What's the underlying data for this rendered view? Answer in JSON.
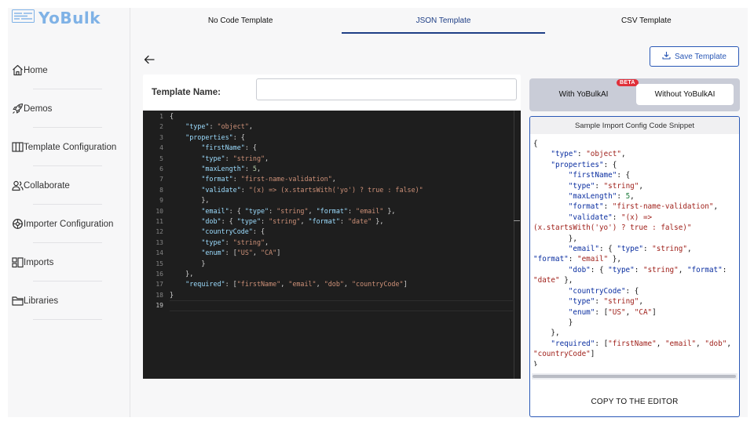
{
  "logo": {
    "text": "YoBulk"
  },
  "nav": [
    {
      "id": "home",
      "label": "Home",
      "icon": "home-icon"
    },
    {
      "id": "demos",
      "label": "Demos",
      "icon": "rocket-icon"
    },
    {
      "id": "template-configuration",
      "label": "Template Configuration",
      "icon": "columns-icon"
    },
    {
      "id": "collaborate",
      "label": "Collaborate",
      "icon": "users-icon"
    },
    {
      "id": "importer-configuration",
      "label": "Importer Configuration",
      "icon": "settings-icon"
    },
    {
      "id": "imports",
      "label": "Imports",
      "icon": "imports-icon"
    },
    {
      "id": "libraries",
      "label": "Libraries",
      "icon": "folder-icon"
    }
  ],
  "tabs": [
    {
      "label": "No Code Template",
      "active": false
    },
    {
      "label": "JSON Template",
      "active": true
    },
    {
      "label": "CSV Template",
      "active": false
    }
  ],
  "save_button": {
    "label": "Save Template"
  },
  "template_name": {
    "label": "Template Name:",
    "value": "",
    "placeholder": ""
  },
  "editor": {
    "current_line": 19,
    "lines": [
      [
        [
          "p",
          "{"
        ]
      ],
      [
        [
          "p",
          "    "
        ],
        [
          "k",
          "\"type\""
        ],
        [
          "p",
          ": "
        ],
        [
          "s",
          "\"object\""
        ],
        [
          "p",
          ","
        ]
      ],
      [
        [
          "p",
          "    "
        ],
        [
          "k",
          "\"properties\""
        ],
        [
          "p",
          ": {"
        ]
      ],
      [
        [
          "p",
          "        "
        ],
        [
          "k",
          "\"firstName\""
        ],
        [
          "p",
          ": {"
        ]
      ],
      [
        [
          "p",
          "        "
        ],
        [
          "k",
          "\"type\""
        ],
        [
          "p",
          ": "
        ],
        [
          "s",
          "\"string\""
        ],
        [
          "p",
          ","
        ]
      ],
      [
        [
          "p",
          "        "
        ],
        [
          "k",
          "\"maxLength\""
        ],
        [
          "p",
          ": "
        ],
        [
          "n",
          "5"
        ],
        [
          "p",
          ","
        ]
      ],
      [
        [
          "p",
          "        "
        ],
        [
          "k",
          "\"format\""
        ],
        [
          "p",
          ": "
        ],
        [
          "s",
          "\"first-name-validation\""
        ],
        [
          "p",
          ","
        ]
      ],
      [
        [
          "p",
          "        "
        ],
        [
          "k",
          "\"validate\""
        ],
        [
          "p",
          ": "
        ],
        [
          "s",
          "\"(x) => (x.startsWith('yo') ? true : false)\""
        ]
      ],
      [
        [
          "p",
          "        },"
        ]
      ],
      [
        [
          "p",
          "        "
        ],
        [
          "k",
          "\"email\""
        ],
        [
          "p",
          ": { "
        ],
        [
          "k",
          "\"type\""
        ],
        [
          "p",
          ": "
        ],
        [
          "s",
          "\"string\""
        ],
        [
          "p",
          ", "
        ],
        [
          "k",
          "\"format\""
        ],
        [
          "p",
          ": "
        ],
        [
          "s",
          "\"email\""
        ],
        [
          "p",
          " },"
        ]
      ],
      [
        [
          "p",
          "        "
        ],
        [
          "k",
          "\"dob\""
        ],
        [
          "p",
          ": { "
        ],
        [
          "k",
          "\"type\""
        ],
        [
          "p",
          ": "
        ],
        [
          "s",
          "\"string\""
        ],
        [
          "p",
          ", "
        ],
        [
          "k",
          "\"format\""
        ],
        [
          "p",
          ": "
        ],
        [
          "s",
          "\"date\""
        ],
        [
          "p",
          " },"
        ]
      ],
      [
        [
          "p",
          "        "
        ],
        [
          "k",
          "\"countryCode\""
        ],
        [
          "p",
          ": {"
        ]
      ],
      [
        [
          "p",
          "        "
        ],
        [
          "k",
          "\"type\""
        ],
        [
          "p",
          ": "
        ],
        [
          "s",
          "\"string\""
        ],
        [
          "p",
          ","
        ]
      ],
      [
        [
          "p",
          "        "
        ],
        [
          "k",
          "\"enum\""
        ],
        [
          "p",
          ": ["
        ],
        [
          "s",
          "\"US\""
        ],
        [
          "p",
          ", "
        ],
        [
          "s",
          "\"CA\""
        ],
        [
          "p",
          "]"
        ]
      ],
      [
        [
          "p",
          "        }"
        ]
      ],
      [
        [
          "p",
          "    },"
        ]
      ],
      [
        [
          "p",
          "    "
        ],
        [
          "k",
          "\"required\""
        ],
        [
          "p",
          ": ["
        ],
        [
          "s",
          "\"firstName\""
        ],
        [
          "p",
          ", "
        ],
        [
          "s",
          "\"email\""
        ],
        [
          "p",
          ", "
        ],
        [
          "s",
          "\"dob\""
        ],
        [
          "p",
          ", "
        ],
        [
          "s",
          "\"countryCode\""
        ],
        [
          "p",
          "]"
        ]
      ],
      [
        [
          "p",
          "}"
        ]
      ],
      []
    ]
  },
  "ai_toggle": {
    "with_label": "With YoBulkAI",
    "beta_label": "BETA",
    "without_label": "Without YoBulkAI",
    "selected": "without"
  },
  "snippet": {
    "title": "Sample Import Config Code Snippet",
    "tokens": [
      [
        "p",
        "{\n    "
      ],
      [
        "k",
        "\"type\""
      ],
      [
        "p",
        ": "
      ],
      [
        "s",
        "\"object\""
      ],
      [
        "p",
        ",\n    "
      ],
      [
        "k",
        "\"properties\""
      ],
      [
        "p",
        ": {\n        "
      ],
      [
        "k",
        "\"firstName\""
      ],
      [
        "p",
        ": {\n        "
      ],
      [
        "k",
        "\"type\""
      ],
      [
        "p",
        ": "
      ],
      [
        "s",
        "\"string\""
      ],
      [
        "p",
        ",\n        "
      ],
      [
        "k",
        "\"maxLength\""
      ],
      [
        "p",
        ": "
      ],
      [
        "n",
        "5"
      ],
      [
        "p",
        ",\n        "
      ],
      [
        "k",
        "\"format\""
      ],
      [
        "p",
        ": "
      ],
      [
        "s",
        "\"first-name-validation\""
      ],
      [
        "p",
        ",\n        "
      ],
      [
        "k",
        "\"validate\""
      ],
      [
        "p",
        ": "
      ],
      [
        "s",
        "\"(x) =>\n(x.startsWith('yo') ? true : false)\""
      ],
      [
        "p",
        "\n        },\n        "
      ],
      [
        "k",
        "\"email\""
      ],
      [
        "p",
        ": { "
      ],
      [
        "k",
        "\"type\""
      ],
      [
        "p",
        ": "
      ],
      [
        "s",
        "\"string\""
      ],
      [
        "p",
        ",\n"
      ],
      [
        "k",
        "\"format\""
      ],
      [
        "p",
        ": "
      ],
      [
        "s",
        "\"email\""
      ],
      [
        "p",
        " },\n        "
      ],
      [
        "k",
        "\"dob\""
      ],
      [
        "p",
        ": { "
      ],
      [
        "k",
        "\"type\""
      ],
      [
        "p",
        ": "
      ],
      [
        "s",
        "\"string\""
      ],
      [
        "p",
        ", "
      ],
      [
        "k",
        "\"format\""
      ],
      [
        "p",
        ":\n"
      ],
      [
        "s",
        "\"date\""
      ],
      [
        "p",
        " },\n        "
      ],
      [
        "k",
        "\"countryCode\""
      ],
      [
        "p",
        ": {\n        "
      ],
      [
        "k",
        "\"type\""
      ],
      [
        "p",
        ": "
      ],
      [
        "s",
        "\"string\""
      ],
      [
        "p",
        ",\n        "
      ],
      [
        "k",
        "\"enum\""
      ],
      [
        "p",
        ": ["
      ],
      [
        "s",
        "\"US\""
      ],
      [
        "p",
        ", "
      ],
      [
        "s",
        "\"CA\""
      ],
      [
        "p",
        "]\n        }\n    },\n    "
      ],
      [
        "k",
        "\"required\""
      ],
      [
        "p",
        ": ["
      ],
      [
        "s",
        "\"firstName\""
      ],
      [
        "p",
        ", "
      ],
      [
        "s",
        "\"email\""
      ],
      [
        "p",
        ", "
      ],
      [
        "s",
        "\"dob\""
      ],
      [
        "p",
        ",\n"
      ],
      [
        "s",
        "\"countryCode\""
      ],
      [
        "p",
        "]\n}"
      ]
    ],
    "copy_label": "COPY TO THE EDITOR"
  },
  "colors": {
    "accent": "#2a58b6",
    "active_tab": "#1f3f86",
    "logo": "#7fb2e6",
    "beta": "#e0303a",
    "editor_bg": "#1e1e1e"
  }
}
